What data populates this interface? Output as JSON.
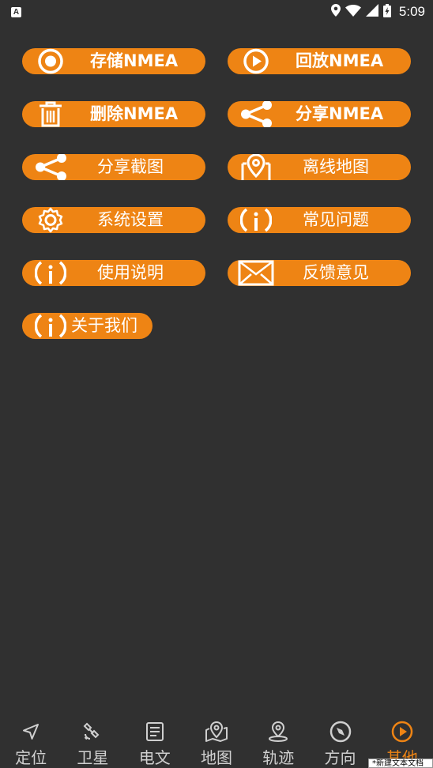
{
  "status_bar": {
    "app_badge": "A",
    "time": "5:09"
  },
  "buttons": [
    {
      "label": "存储NMEA",
      "icon": "record-icon"
    },
    {
      "label": "回放NMEA",
      "icon": "play-icon"
    },
    {
      "label": "删除NMEA",
      "icon": "trash-icon"
    },
    {
      "label": "分享NMEA",
      "icon": "share-icon"
    },
    {
      "label": "分享截图",
      "icon": "share-icon"
    },
    {
      "label": "离线地图",
      "icon": "map-pin-icon"
    },
    {
      "label": "系统设置",
      "icon": "gear-icon"
    },
    {
      "label": "常见问题",
      "icon": "info-icon"
    },
    {
      "label": "使用说明",
      "icon": "info-icon"
    },
    {
      "label": "反馈意见",
      "icon": "mail-icon"
    },
    {
      "label": "关于我们",
      "icon": "info-icon"
    }
  ],
  "nav": [
    {
      "label": "定位",
      "icon": "navigation-arrow-icon"
    },
    {
      "label": "卫星",
      "icon": "satellite-icon"
    },
    {
      "label": "电文",
      "icon": "document-icon"
    },
    {
      "label": "地图",
      "icon": "map-icon"
    },
    {
      "label": "轨迹",
      "icon": "track-pin-icon"
    },
    {
      "label": "方向",
      "icon": "compass-icon"
    },
    {
      "label": "其他",
      "icon": "play-circle-icon",
      "active": true
    }
  ],
  "tooltip": "*新建文本文档",
  "colors": {
    "background": "#303030",
    "accent": "#ee8414",
    "nav_label": "#cfcfcf"
  }
}
